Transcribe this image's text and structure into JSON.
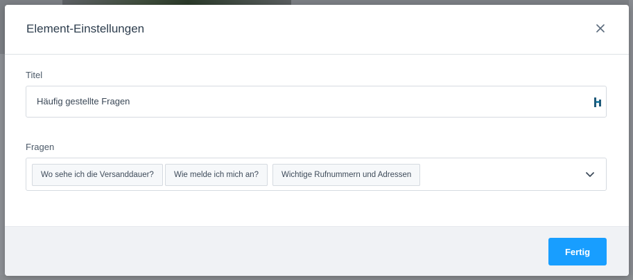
{
  "modal": {
    "title": "Element-Einstellungen",
    "close_icon": "close-icon"
  },
  "title_field": {
    "label": "Titel",
    "value": "Häufig gestellte Fragen",
    "icon": "translation-icon"
  },
  "questions_field": {
    "label": "Fragen",
    "tags": [
      "Wo sehe ich die Versanddauer?",
      "Wie melde ich mich an?",
      "Wichtige Rufnummern und Adressen"
    ],
    "dropdown_icon": "chevron-down-icon"
  },
  "footer": {
    "done_label": "Fertig"
  },
  "colors": {
    "accent": "#189eff",
    "title_text": "#2d3d4d",
    "border": "#d5dae0",
    "footer_bg": "#f0f2f5"
  }
}
